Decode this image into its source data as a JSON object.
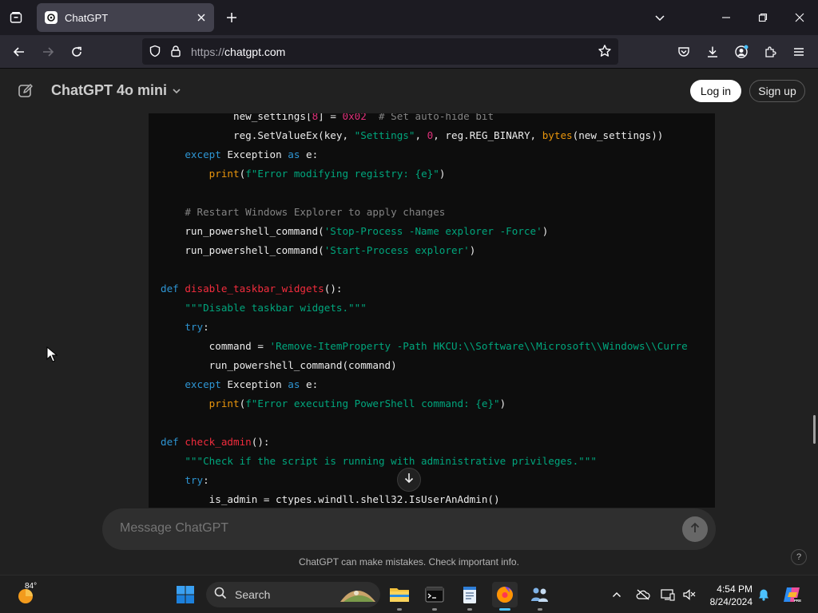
{
  "browser": {
    "tab_title": "ChatGPT",
    "url_protocol": "https://",
    "url_host": "chatgpt.com"
  },
  "header": {
    "model_name": "ChatGPT 4o mini",
    "login_label": "Log in",
    "signup_label": "Sign up"
  },
  "code_lines": [
    [
      {
        "t": "            new_settings[",
        "c": ""
      },
      {
        "t": "8",
        "c": "num"
      },
      {
        "t": "] = ",
        "c": ""
      },
      {
        "t": "0x02",
        "c": "num"
      },
      {
        "t": "  ",
        "c": ""
      },
      {
        "t": "# Set auto-hide bit",
        "c": "cm"
      }
    ],
    [
      {
        "t": "            reg.SetValueEx(key, ",
        "c": ""
      },
      {
        "t": "\"Settings\"",
        "c": "str"
      },
      {
        "t": ", ",
        "c": ""
      },
      {
        "t": "0",
        "c": "num"
      },
      {
        "t": ", reg.REG_BINARY, ",
        "c": ""
      },
      {
        "t": "bytes",
        "c": "bi"
      },
      {
        "t": "(new_settings))",
        "c": ""
      }
    ],
    [
      {
        "t": "    ",
        "c": ""
      },
      {
        "t": "except",
        "c": "kw"
      },
      {
        "t": " Exception ",
        "c": ""
      },
      {
        "t": "as",
        "c": "kw"
      },
      {
        "t": " e:",
        "c": ""
      }
    ],
    [
      {
        "t": "        ",
        "c": ""
      },
      {
        "t": "print",
        "c": "bi"
      },
      {
        "t": "(",
        "c": ""
      },
      {
        "t": "f\"Error modifying registry: {e}\"",
        "c": "str"
      },
      {
        "t": ")",
        "c": ""
      }
    ],
    [],
    [
      {
        "t": "    ",
        "c": ""
      },
      {
        "t": "# Restart Windows Explorer to apply changes",
        "c": "cm"
      }
    ],
    [
      {
        "t": "    run_powershell_command(",
        "c": ""
      },
      {
        "t": "'Stop-Process -Name explorer -Force'",
        "c": "str"
      },
      {
        "t": ")",
        "c": ""
      }
    ],
    [
      {
        "t": "    run_powershell_command(",
        "c": ""
      },
      {
        "t": "'Start-Process explorer'",
        "c": "str"
      },
      {
        "t": ")",
        "c": ""
      }
    ],
    [],
    [
      {
        "t": "def",
        "c": "kw"
      },
      {
        "t": " ",
        "c": ""
      },
      {
        "t": "disable_taskbar_widgets",
        "c": "fn"
      },
      {
        "t": "():",
        "c": ""
      }
    ],
    [
      {
        "t": "    ",
        "c": ""
      },
      {
        "t": "\"\"\"Disable taskbar widgets.\"\"\"",
        "c": "str"
      }
    ],
    [
      {
        "t": "    ",
        "c": ""
      },
      {
        "t": "try",
        "c": "kw"
      },
      {
        "t": ":",
        "c": ""
      }
    ],
    [
      {
        "t": "        command = ",
        "c": ""
      },
      {
        "t": "'Remove-ItemProperty -Path HKCU:\\\\Software\\\\Microsoft\\\\Windows\\\\Curre",
        "c": "str"
      }
    ],
    [
      {
        "t": "        run_powershell_command(command)",
        "c": ""
      }
    ],
    [
      {
        "t": "    ",
        "c": ""
      },
      {
        "t": "except",
        "c": "kw"
      },
      {
        "t": " Exception ",
        "c": ""
      },
      {
        "t": "as",
        "c": "kw"
      },
      {
        "t": " e:",
        "c": ""
      }
    ],
    [
      {
        "t": "        ",
        "c": ""
      },
      {
        "t": "print",
        "c": "bi"
      },
      {
        "t": "(",
        "c": ""
      },
      {
        "t": "f\"Error executing PowerShell command: {e}\"",
        "c": "str"
      },
      {
        "t": ")",
        "c": ""
      }
    ],
    [],
    [
      {
        "t": "def",
        "c": "kw"
      },
      {
        "t": " ",
        "c": ""
      },
      {
        "t": "check_admin",
        "c": "fn"
      },
      {
        "t": "():",
        "c": ""
      }
    ],
    [
      {
        "t": "    ",
        "c": ""
      },
      {
        "t": "\"\"\"Check if the script is running with administrative privileges.\"\"\"",
        "c": "str"
      }
    ],
    [
      {
        "t": "    ",
        "c": ""
      },
      {
        "t": "try",
        "c": "kw"
      },
      {
        "t": ":",
        "c": ""
      }
    ],
    [
      {
        "t": "        is_admin = ctypes.windll.shell32.IsUserAnAdmin()",
        "c": ""
      }
    ]
  ],
  "composer": {
    "placeholder": "Message ChatGPT",
    "disclaimer": "ChatGPT can make mistakes. Check important info.",
    "help_label": "?"
  },
  "taskbar": {
    "weather_temp": "84°",
    "search_label": "Search",
    "time": "4:54 PM",
    "date": "8/24/2024"
  },
  "colors": {
    "accent": "#4cc2ff",
    "keyword": "#2e95d3",
    "function": "#f22c3d",
    "string": "#00a67d",
    "number": "#df3079",
    "comment": "#848484"
  }
}
